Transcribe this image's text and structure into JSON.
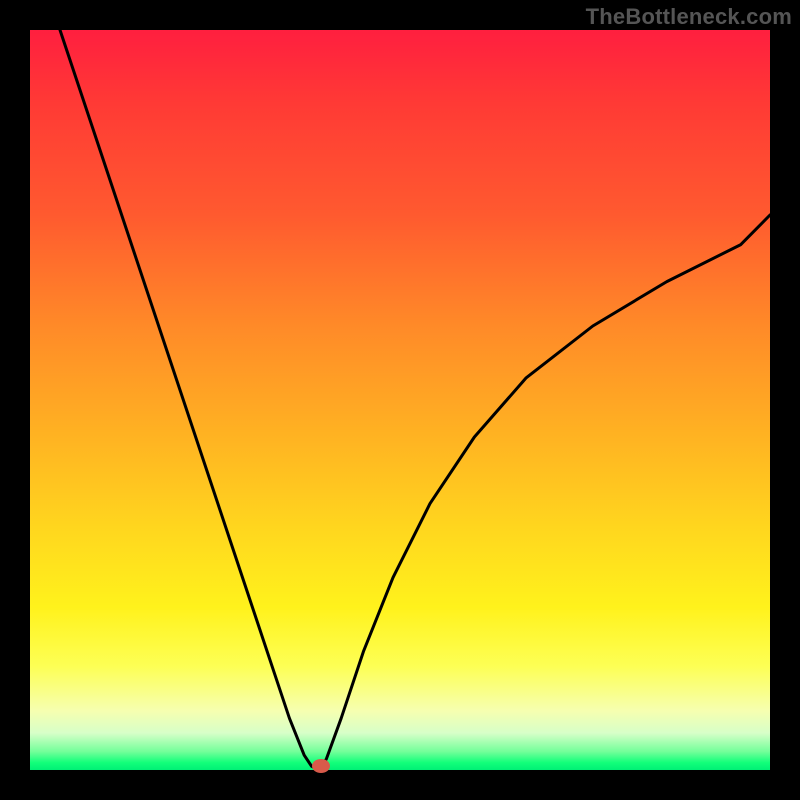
{
  "watermark": "TheBottleneck.com",
  "colors": {
    "frame_bg": "#000000",
    "curve_stroke": "#000000",
    "marker_fill": "#d85a4a",
    "gradient_top": "#ff1f3f",
    "gradient_bottom": "#00f076"
  },
  "chart_data": {
    "type": "line",
    "title": "",
    "xlabel": "",
    "ylabel": "",
    "xlim": [
      0,
      100
    ],
    "ylim": [
      0,
      100
    ],
    "series": [
      {
        "name": "bottleneck-curve",
        "x": [
          0,
          5,
          10,
          15,
          20,
          23,
          25,
          27,
          29,
          31,
          33,
          34,
          35,
          36,
          38,
          41,
          45,
          50,
          56,
          63,
          72,
          82,
          92,
          100
        ],
        "values": [
          100,
          85,
          70,
          55,
          40,
          31,
          25,
          19,
          13,
          7,
          2,
          0.5,
          0,
          1.5,
          7,
          16,
          26,
          36,
          45,
          53,
          60,
          66,
          71,
          75
        ]
      }
    ],
    "annotations": [
      {
        "name": "min-marker",
        "x": 35,
        "y": 0,
        "color": "#d85a4a",
        "shape": "ellipse"
      }
    ],
    "grid": false,
    "legend": false
  }
}
